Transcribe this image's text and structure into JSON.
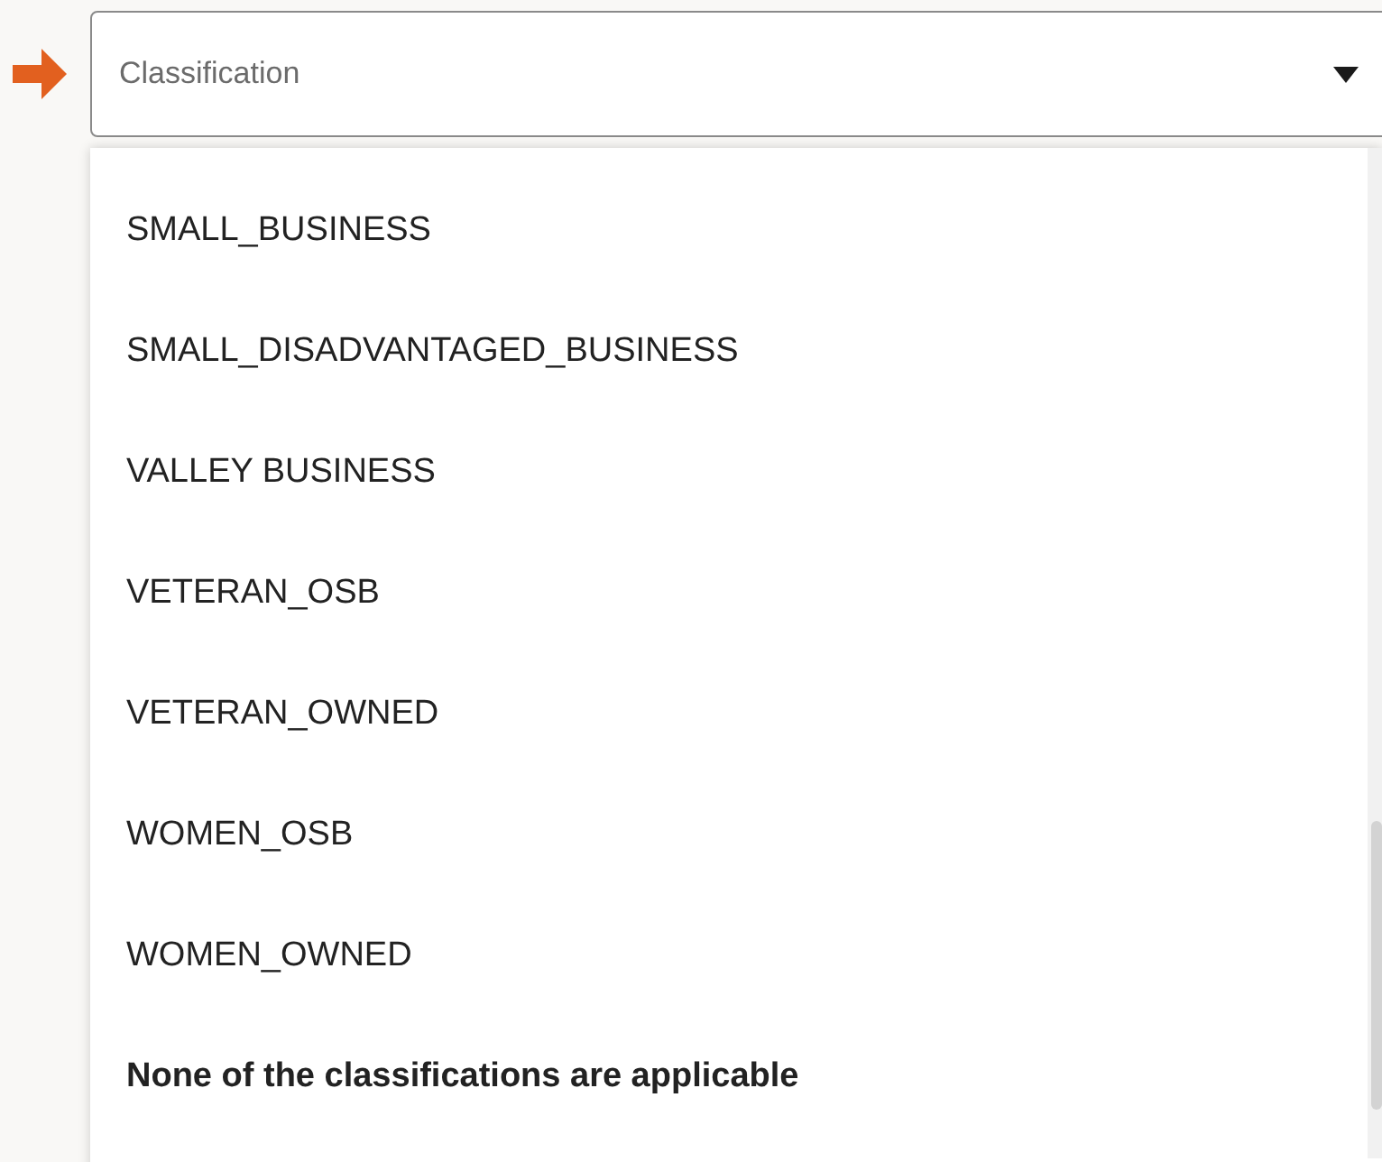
{
  "classification_select": {
    "placeholder": "Classification"
  },
  "options": [
    {
      "label": "SMALL_BUSINESS",
      "kind": "option"
    },
    {
      "label": "SMALL_DISADVANTAGED_BUSINESS",
      "kind": "option"
    },
    {
      "label": "VALLEY BUSINESS",
      "kind": "option"
    },
    {
      "label": "VETERAN_OSB",
      "kind": "option"
    },
    {
      "label": "VETERAN_OWNED",
      "kind": "option"
    },
    {
      "label": "WOMEN_OSB",
      "kind": "option"
    },
    {
      "label": "WOMEN_OWNED",
      "kind": "option"
    },
    {
      "label": "None of the classifications are applicable",
      "kind": "none"
    }
  ]
}
